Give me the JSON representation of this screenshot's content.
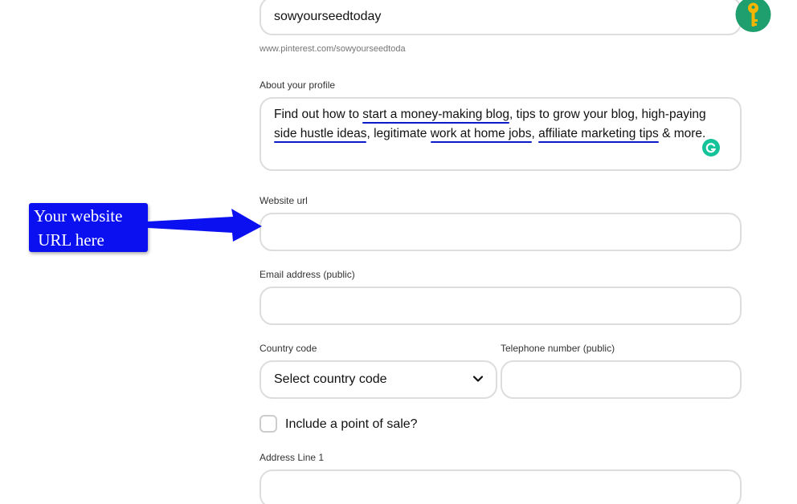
{
  "username": {
    "value": "sowyourseedtoday",
    "helper": "www.pinterest.com/sowyourseedtoda"
  },
  "about": {
    "label": "About your profile",
    "segments": [
      "Find out how to ",
      "start a money-making blog",
      ", tips to grow your blog, high-paying ",
      "side hustle ideas",
      ", legitimate ",
      "work at home jobs",
      ", ",
      "affiliate marketing tips",
      " & more."
    ]
  },
  "website": {
    "label": "Website url",
    "value": "",
    "placeholder": ""
  },
  "email": {
    "label": "Email address (public)",
    "value": "",
    "placeholder": ""
  },
  "country": {
    "label": "Country code",
    "selected": "Select country code",
    "icon": "chevron-down-icon"
  },
  "telephone": {
    "label": "Telephone number (public)",
    "value": "",
    "placeholder": ""
  },
  "point_of_sale": {
    "label": "Include a point of sale?",
    "checked": false
  },
  "address": {
    "label": "Address Line 1",
    "value": "",
    "placeholder": ""
  },
  "annotation": {
    "text": "Your website\n URL here",
    "color": "#0a10f0"
  },
  "extensions": {
    "key_icon": "key-icon",
    "key_bg": "#1f9e6e",
    "grammarly_icon": "grammarly-icon",
    "grammarly_color": "#15c39a"
  },
  "colors": {
    "underline": "#0a1bc8",
    "border": "#dddddd",
    "helper_text": "#767676"
  }
}
